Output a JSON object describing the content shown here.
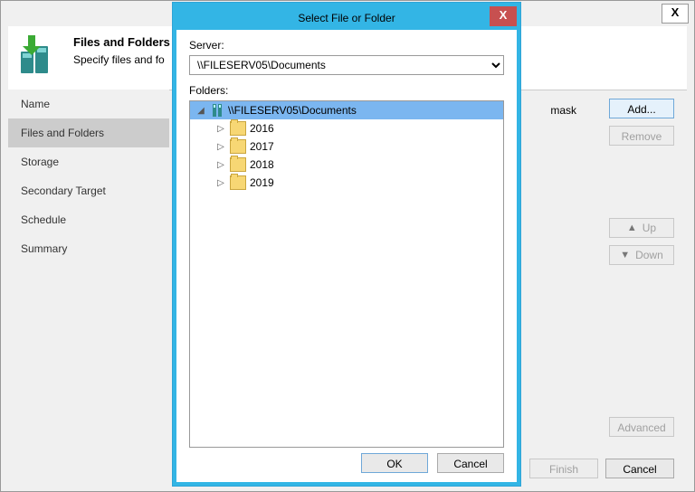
{
  "main": {
    "close": "X",
    "header_title": "Files and Folders",
    "header_subtitle": "Specify files and fo",
    "mask_label": "mask"
  },
  "nav": {
    "items": [
      {
        "label": "Name"
      },
      {
        "label": "Files and Folders"
      },
      {
        "label": "Storage"
      },
      {
        "label": "Secondary Target"
      },
      {
        "label": "Schedule"
      },
      {
        "label": "Summary"
      }
    ],
    "active_index": 1
  },
  "buttons": {
    "add": "Add...",
    "remove": "Remove",
    "up": "Up",
    "down": "Down",
    "advanced": "Advanced",
    "finish": "Finish",
    "cancel": "Cancel"
  },
  "modal": {
    "title": "Select File or Folder",
    "close": "X",
    "server_label": "Server:",
    "server_value": "\\\\FILESERV05\\Documents",
    "folders_label": "Folders:",
    "root": "\\\\FILESERV05\\Documents",
    "children": [
      {
        "label": "2016"
      },
      {
        "label": "2017"
      },
      {
        "label": "2018"
      },
      {
        "label": "2019"
      }
    ],
    "ok": "OK",
    "cancel": "Cancel"
  }
}
